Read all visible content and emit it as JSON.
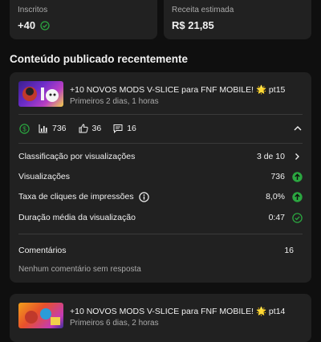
{
  "stats": {
    "subscribers": {
      "label": "Inscritos",
      "value": "+40"
    },
    "revenue": {
      "label": "Receita estimada",
      "value": "R$ 21,85"
    }
  },
  "section": {
    "title": "Conteúdo publicado recentemente"
  },
  "videos": [
    {
      "title": "+10 NOVOS MODS V-SLICE para FNF MOBILE! 🌟 pt15",
      "meta": "Primeiros 2 dias, 1 horas",
      "views_count": "736",
      "likes_count": "36",
      "comments_count": "16",
      "metrics": [
        {
          "label": "Classificação por visualizações",
          "value": "3 de 10"
        },
        {
          "label": "Visualizações",
          "value": "736"
        },
        {
          "label": "Taxa de cliques de impressões",
          "value": "8,0%"
        },
        {
          "label": "Duração média da visualização",
          "value": "0:47"
        }
      ],
      "comments": {
        "label": "Comentários",
        "value": "16",
        "note": "Nenhum comentário sem resposta"
      }
    },
    {
      "title": "+10 NOVOS MODS V-SLICE para FNF MOBILE! 🌟 pt14",
      "meta": "Primeiros 6 dias, 2 horas"
    }
  ],
  "icons": {
    "check": "check-circle-icon",
    "monetization": "dollar-circle-icon",
    "views": "bar-chart-icon",
    "likes": "thumbs-up-icon",
    "comments": "comment-icon",
    "collapse": "chevron-up-icon",
    "more": "chevron-right-icon",
    "up_arrow": "arrow-up-circle-icon",
    "info": "info-icon"
  },
  "colors": {
    "accent_green": "#2ba640",
    "background": "#0f0f0f",
    "card": "#212121"
  }
}
